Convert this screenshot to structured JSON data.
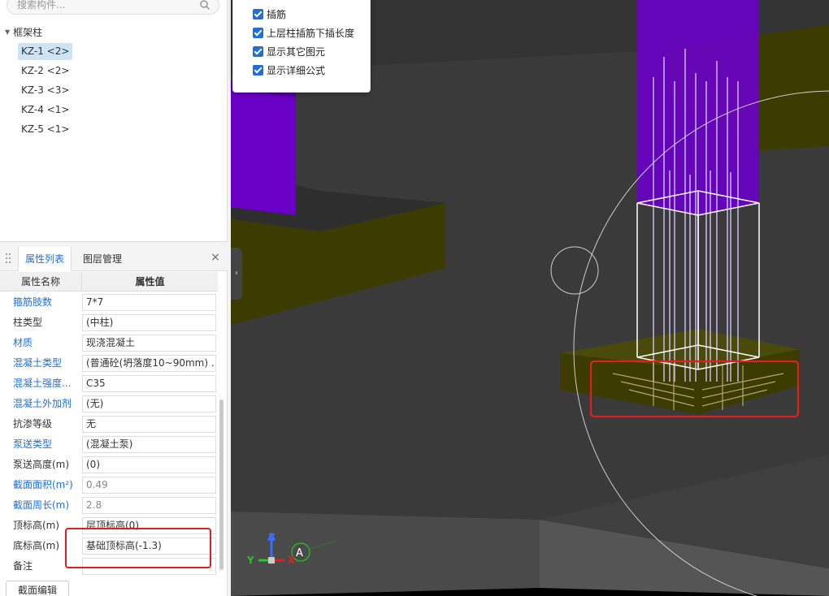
{
  "search": {
    "placeholder": "搜索构件..."
  },
  "tree": {
    "root_label": "框架柱",
    "items": [
      {
        "label": "KZ-1 <2>",
        "selected": true
      },
      {
        "label": "KZ-2 <2>",
        "selected": false
      },
      {
        "label": "KZ-3 <3>",
        "selected": false
      },
      {
        "label": "KZ-4 <1>",
        "selected": false
      },
      {
        "label": "KZ-5 <1>",
        "selected": false
      }
    ]
  },
  "properties_panel": {
    "tabs": [
      "属性列表",
      "图层管理"
    ],
    "active_tab": "属性列表",
    "header": {
      "name": "属性名称",
      "value": "属性值"
    },
    "rows": [
      {
        "name": "箍筋肢数",
        "value": "7*7"
      },
      {
        "name": "柱类型",
        "value": "(中柱)"
      },
      {
        "name": "材质",
        "value": "现浇混凝土"
      },
      {
        "name": "混凝土类型",
        "value": "(普通砼(坍落度10~90mm) ..."
      },
      {
        "name": "混凝土强度...",
        "value": "C35"
      },
      {
        "name": "混凝土外加剂",
        "value": "(无)"
      },
      {
        "name": "抗渗等级",
        "value": "无"
      },
      {
        "name": "泵送类型",
        "value": "(混凝土泵)"
      },
      {
        "name": "泵送高度(m)",
        "value": "(0)"
      },
      {
        "name": "截面面积(m²)",
        "value": "0.49"
      },
      {
        "name": "截面周长(m)",
        "value": "2.8"
      },
      {
        "name": "顶标高(m)",
        "value": "层顶标高(0)"
      },
      {
        "name": "底标高(m)",
        "value": "基础顶标高(-1.3)"
      },
      {
        "name": "备注",
        "value": ""
      }
    ],
    "bottom_button": "截面编辑"
  },
  "options_popup": {
    "items": [
      {
        "label": "插筋",
        "checked": true
      },
      {
        "label": "上层柱插筋下插长度",
        "checked": true
      },
      {
        "label": "显示其它图元",
        "checked": true
      },
      {
        "label": "显示详细公式",
        "checked": true
      }
    ]
  },
  "viewport": {
    "axis_labels": {
      "z": "Z",
      "y": "Y",
      "x": "X"
    },
    "grid_label": "A"
  },
  "colors": {
    "accent": "#1e6fd9",
    "column_purple": "#6a00c8",
    "slab_olive": "#3c3c00",
    "highlight_red": "#e02020"
  }
}
